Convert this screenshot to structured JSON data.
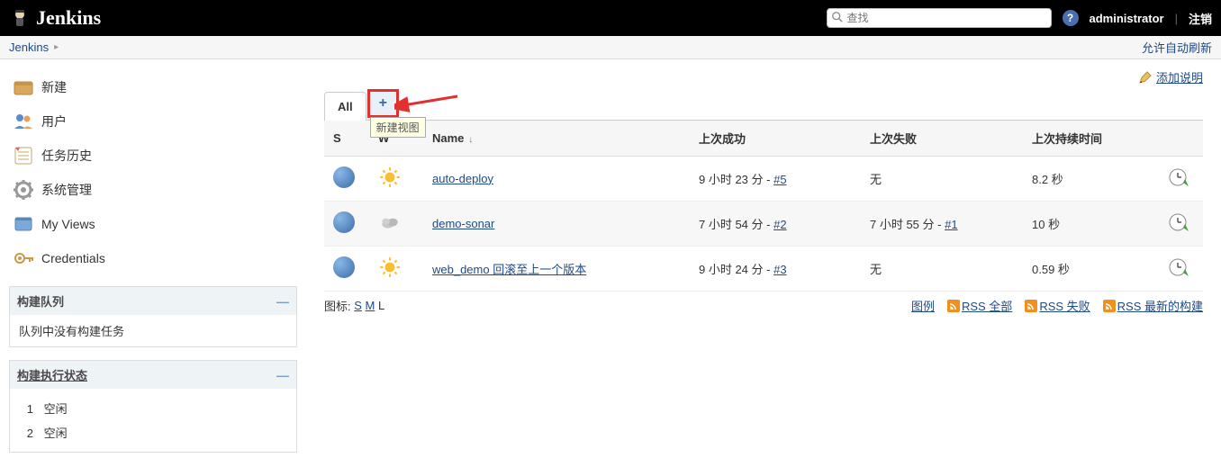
{
  "header": {
    "title": "Jenkins",
    "search_placeholder": "查找",
    "user": "administrator",
    "logout": "注销"
  },
  "breadcrumb": {
    "root": "Jenkins",
    "auto_refresh": "允许自动刷新"
  },
  "sidebar": {
    "items": [
      {
        "label": "新建",
        "icon": "new"
      },
      {
        "label": "用户",
        "icon": "users"
      },
      {
        "label": "任务历史",
        "icon": "history"
      },
      {
        "label": "系统管理",
        "icon": "gear"
      },
      {
        "label": "My Views",
        "icon": "views"
      },
      {
        "label": "Credentials",
        "icon": "credentials"
      }
    ],
    "build_queue": {
      "title": "构建队列",
      "empty": "队列中没有构建任务"
    },
    "build_exec": {
      "title": "构建执行状态",
      "executors": [
        {
          "num": "1",
          "label": "空闲"
        },
        {
          "num": "2",
          "label": "空闲"
        }
      ]
    }
  },
  "main": {
    "add_desc": "添加说明",
    "tabs": {
      "all": "All",
      "new_tooltip": "新建视图",
      "plus": "+"
    },
    "columns": {
      "s": "S",
      "w": "W",
      "name": "Name",
      "last_success": "上次成功",
      "last_failure": "上次失败",
      "last_duration": "上次持续时间"
    },
    "jobs": [
      {
        "name": "auto-deploy",
        "weather": "sunny",
        "success": "9 小时 23 分 - ",
        "success_build": "#5",
        "failure": "无",
        "duration": "8.2 秒"
      },
      {
        "name": "demo-sonar",
        "weather": "cloudy",
        "success": "7 小时 54 分 - ",
        "success_build": "#2",
        "failure": "7 小时 55 分 - ",
        "failure_build": "#1",
        "duration": "10 秒"
      },
      {
        "name": "web_demo 回滚至上一个版本",
        "weather": "sunny",
        "success": "9 小时 24 分 - ",
        "success_build": "#3",
        "failure": "无",
        "duration": "0.59 秒"
      }
    ],
    "footer": {
      "icon_label": "图标:",
      "sizes": [
        "S",
        "M",
        "L"
      ],
      "legend": "图例",
      "rss_all": "RSS 全部",
      "rss_fail": "RSS 失败",
      "rss_latest": "RSS 最新的构建"
    }
  }
}
